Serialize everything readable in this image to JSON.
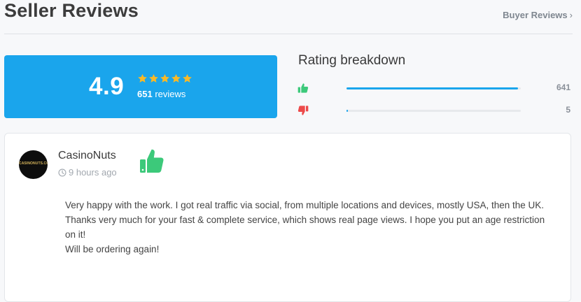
{
  "header": {
    "title": "Seller Reviews",
    "buyer_reviews_link": "Buyer Reviews",
    "chevron": "›"
  },
  "score": {
    "average": "4.9",
    "stars": 5,
    "count": "651",
    "count_label": "reviews",
    "star_color": "#f7b928",
    "box_color": "#1aa5ec"
  },
  "breakdown": {
    "title": "Rating breakdown",
    "rows": [
      {
        "icon": "thumbs-up-icon",
        "count": "641",
        "fraction": 0.9846,
        "color": "#3cc97a"
      },
      {
        "icon": "thumbs-down-icon",
        "count": "5",
        "fraction": 0.0077,
        "color": "#ec4a4a"
      }
    ]
  },
  "review": {
    "reviewer": "CasinoNuts",
    "avatar_text": "CASINONUTS.COM",
    "time": "9 hours ago",
    "sentiment_icon": "thumbs-up-icon",
    "paragraphs": [
      "Very happy with the work. I got real traffic via social, from multiple locations and devices, mostly USA, then the UK.",
      "Thanks very much for your fast & complete service, which shows real page views. I hope you put an age restriction on it!",
      "Will be ordering again!"
    ]
  }
}
